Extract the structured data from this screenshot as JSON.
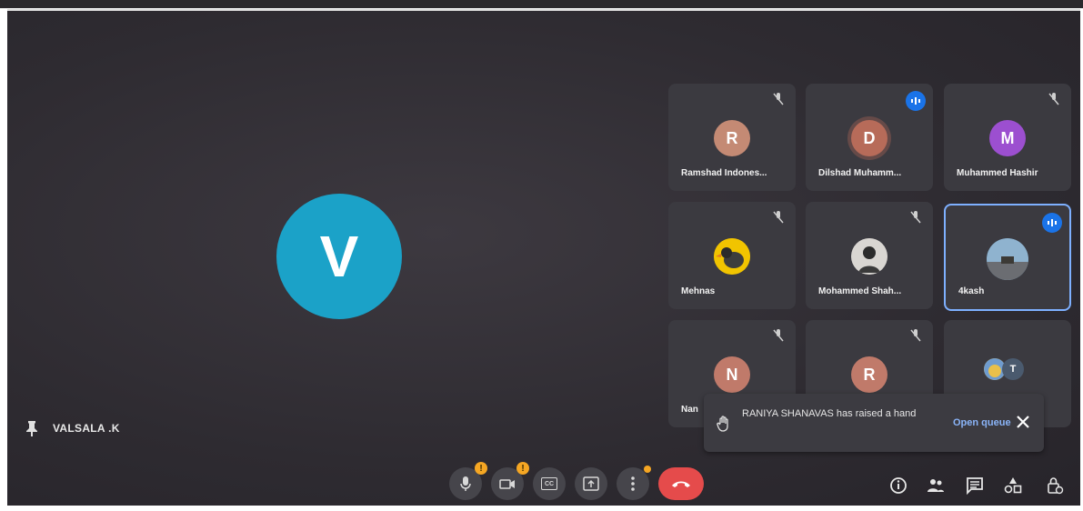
{
  "main": {
    "avatar_letter": "V",
    "avatar_color": "#1ba2c8",
    "name": "VALSALA .K"
  },
  "tiles": [
    {
      "name": "Ramshad Indones...",
      "initial": "R",
      "color": "#c48a74",
      "state": "muted"
    },
    {
      "name": "Dilshad Muhamm...",
      "initial": "D",
      "color": "#b76b59",
      "state": "speaking"
    },
    {
      "name": "Muhammed Hashir",
      "initial": "M",
      "color": "#9c4fd0",
      "state": "muted"
    },
    {
      "name": "Mehnas",
      "initial": "",
      "color": "#f1c400",
      "state": "muted"
    },
    {
      "name": "Mohammed Shah...",
      "initial": "",
      "color": "#c8c4c0",
      "state": "muted"
    },
    {
      "name": "4kash",
      "initial": "",
      "color": "#5b86a8",
      "state": "speaking"
    },
    {
      "name": "Nan",
      "initial": "N",
      "color": "#c07a6a",
      "state": "muted"
    },
    {
      "name": "",
      "initial": "R",
      "color": "#c07a6a",
      "state": "muted"
    },
    {
      "name": "",
      "initial": "T",
      "color": "#4a5a6e",
      "state": "group"
    }
  ],
  "notice": {
    "message": "RANIYA SHANAVAS has raised a hand",
    "action": "Open queue"
  },
  "controls": {
    "mic": "mic-icon",
    "camera": "camera-icon",
    "captions": "CC",
    "present": "present-icon",
    "more": "more-icon",
    "end": "end-call-icon"
  },
  "right_icons": [
    "info-icon",
    "people-icon",
    "chat-icon",
    "activities-icon",
    "host-controls-icon"
  ]
}
